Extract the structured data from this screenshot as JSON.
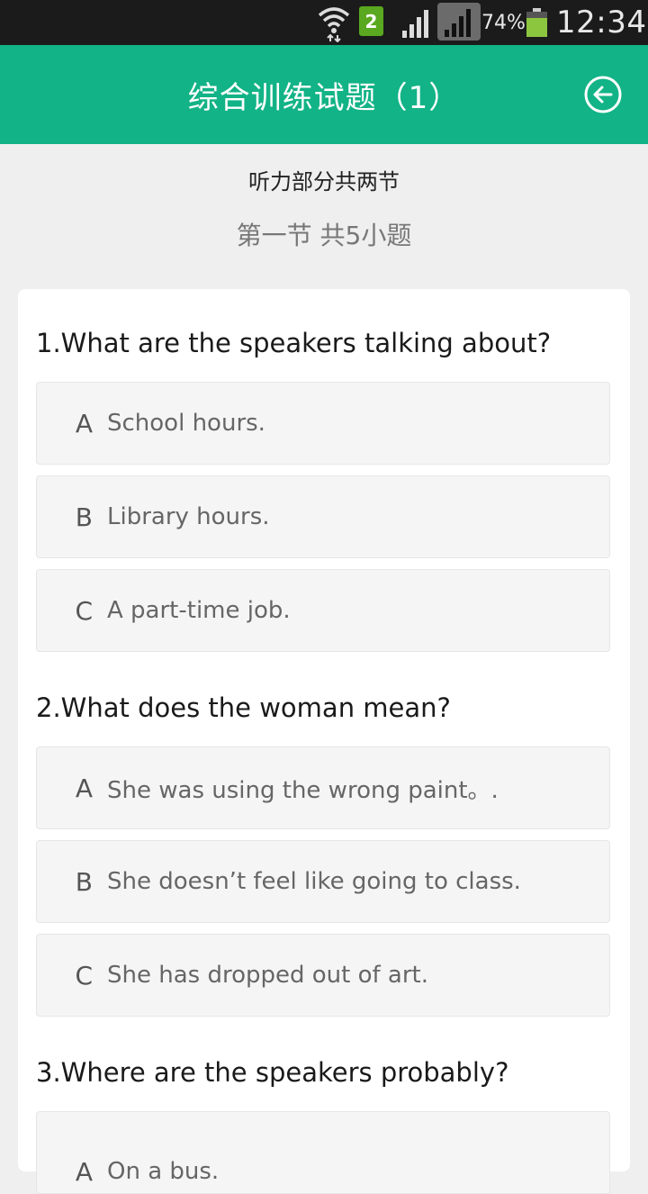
{
  "status_bar": {
    "sim_badge": "2",
    "battery_percent": "74%",
    "battery_level": 0.74,
    "time": "12:34",
    "icons": [
      "wifi-icon",
      "sim-icon",
      "signal-icon",
      "signal-icon",
      "battery-icon"
    ]
  },
  "header": {
    "title": "综合训练试题（1）",
    "back_icon": "back-arrow-circle-icon",
    "color": "#12b386"
  },
  "section": {
    "title": "听力部分共两节",
    "subtitle": "第一节   共5小题"
  },
  "questions": [
    {
      "text": "1.What are the speakers talking about?",
      "options": [
        {
          "letter": "A",
          "text": "School hours."
        },
        {
          "letter": "B",
          "text": "Library hours."
        },
        {
          "letter": "C",
          "text": "A part-time job."
        }
      ]
    },
    {
      "text": "2.What does the woman mean?",
      "options": [
        {
          "letter": "A",
          "text": "She was using the wrong paint。."
        },
        {
          "letter": "B",
          "text": "She doesn’t feel like going to class."
        },
        {
          "letter": "C",
          "text": "She has dropped out of art."
        }
      ]
    },
    {
      "text": "3.Where are the speakers probably?",
      "options": [
        {
          "letter": "A",
          "text": "On a bus."
        }
      ]
    }
  ]
}
